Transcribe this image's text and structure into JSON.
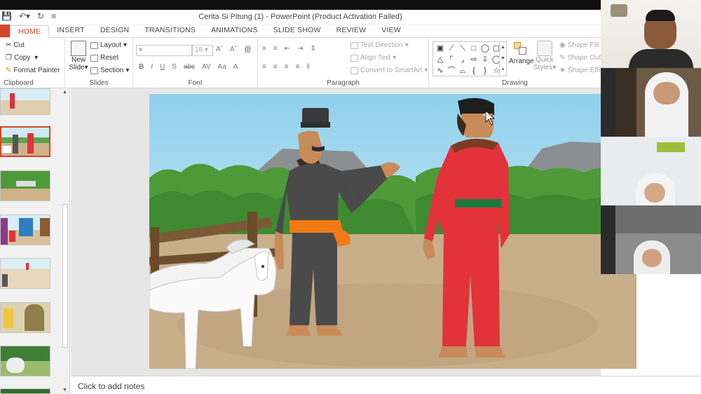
{
  "window": {
    "title": "Cerita Si Pitung (1) - PowerPoint (Product Activation Failed)"
  },
  "tabs": [
    "HOME",
    "INSERT",
    "DESIGN",
    "TRANSITIONS",
    "ANIMATIONS",
    "SLIDE SHOW",
    "REVIEW",
    "VIEW"
  ],
  "ribbon": {
    "clipboard": {
      "cut": "Cut",
      "copy": "Copy",
      "format_painter": "Format Painter",
      "label": "Clipboard"
    },
    "slides": {
      "new_slide_line1": "New",
      "new_slide_line2": "Slide",
      "layout": "Layout",
      "reset": "Reset",
      "section": "Section",
      "label": "Slides"
    },
    "font": {
      "size": "18",
      "label": "Font"
    },
    "paragraph": {
      "text_direction": "Text Direction",
      "align_text": "Align Text",
      "convert_smartart": "Convert to SmartArt",
      "label": "Paragraph"
    },
    "drawing": {
      "arrange": "Arrange",
      "quick_styles_line1": "Quick",
      "quick_styles_line2": "Styles",
      "shape_fill": "Shape Fill",
      "shape_outline": "Shape Outl",
      "shape_effects": "Shape Effe",
      "label": "Drawing"
    }
  },
  "notes": {
    "placeholder": "Click to add notes"
  },
  "colors": {
    "accent": "#d24726",
    "ribbon_bg": "#ffffff",
    "pane_bg": "#f1f1f1",
    "canvas_bg": "#e6e6e6",
    "sky": "#bfe6f4",
    "ground": "#c8ae8a",
    "trees": "#4f9a3a",
    "pitung_red": "#e2323a",
    "man_shirt": "#4a4a4a",
    "sash_orange": "#f07a14"
  },
  "icons": [
    "save-icon",
    "undo-icon",
    "redo-icon",
    "customize-icon",
    "cut-icon",
    "copy-icon",
    "format-painter-icon",
    "new-slide-icon",
    "layout-icon",
    "reset-icon",
    "section-icon",
    "arrange-icon",
    "quick-styles-icon",
    "shape-fill-icon",
    "shape-outline-icon",
    "shape-effects-icon"
  ]
}
